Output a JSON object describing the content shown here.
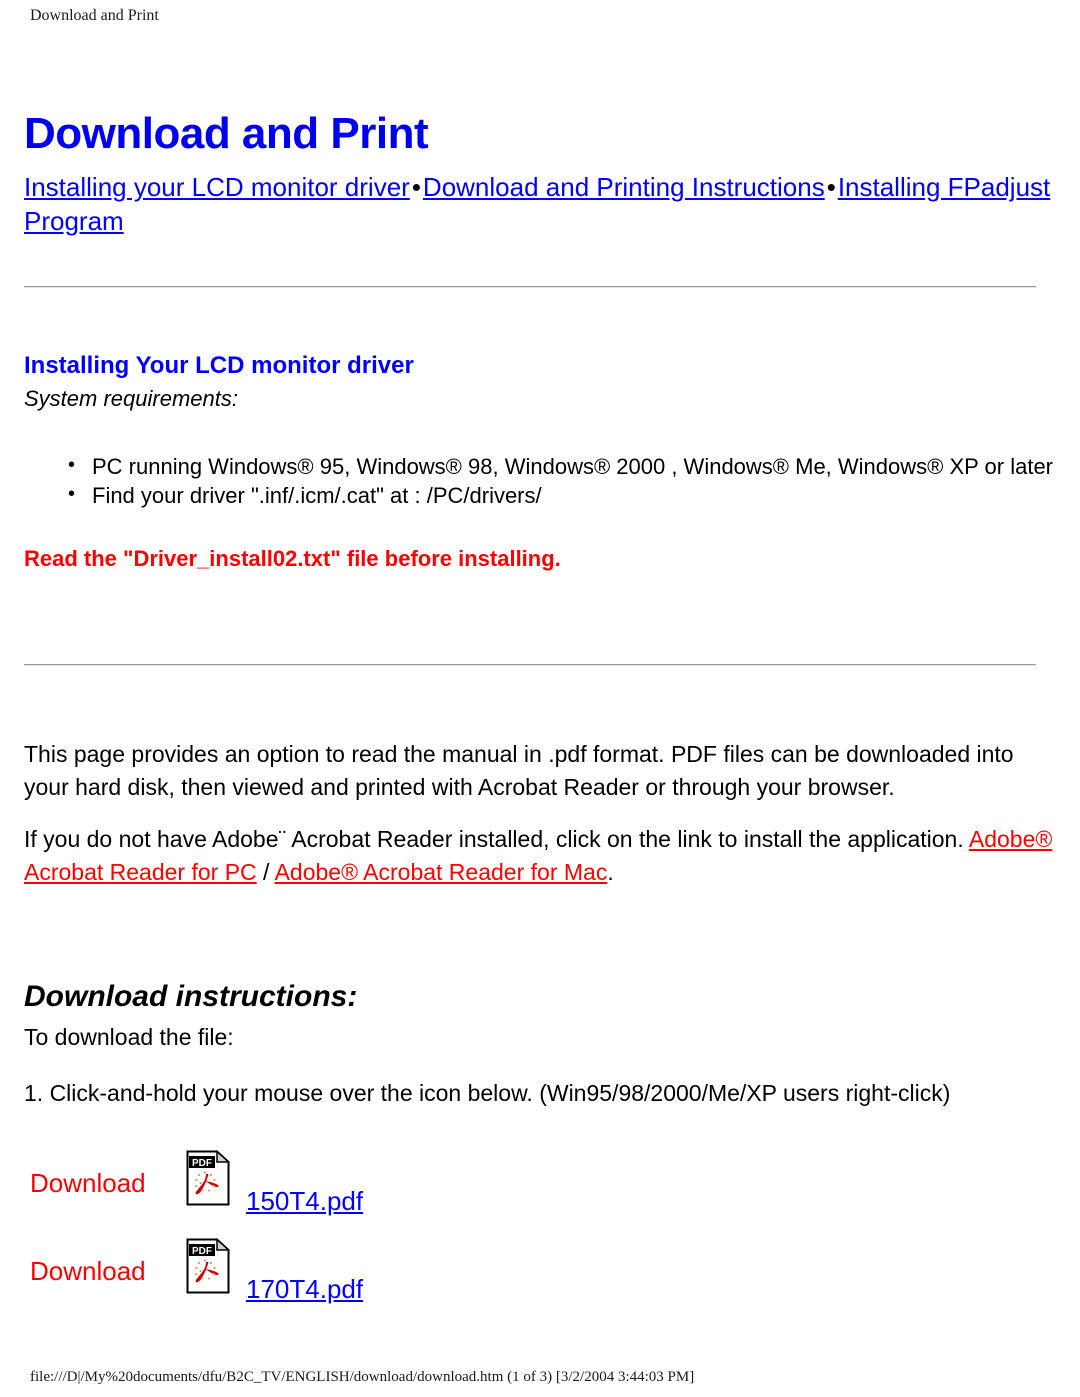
{
  "header": {
    "running_title": "Download and Print"
  },
  "title": "Download and Print",
  "nav": {
    "links": [
      {
        "label": "Installing your LCD monitor driver"
      },
      {
        "label": "Download and Printing Instructions"
      },
      {
        "label": "Installing FPadjust Program"
      }
    ],
    "separator": "•"
  },
  "driver_section": {
    "heading": "Installing Your LCD monitor driver",
    "subheading": "System requirements:",
    "requirements": [
      "PC running Windows® 95, Windows® 98, Windows® 2000 , Windows® Me, Windows® XP or later",
      "Find your driver \".inf/.icm/.cat\" at : /PC/drivers/"
    ],
    "warning": "Read the \"Driver_install02.txt\" file before installing."
  },
  "pdf_section": {
    "paragraph1": "This page provides an option to read the manual in .pdf format. PDF files can be downloaded into your hard disk, then viewed and printed with Acrobat Reader or through your browser.",
    "paragraph2_pre": "If you do not have Adobe¨ Acrobat Reader installed, click on the link to install the application. ",
    "link_pc": "Adobe® Acrobat Reader for PC",
    "paragraph2_mid": " / ",
    "link_mac": "Adobe® Acrobat Reader for Mac",
    "paragraph2_post": "."
  },
  "download_section": {
    "heading": "Download instructions:",
    "intro": "To download the file:",
    "step1": "1. Click-and-hold your mouse over the icon below. (Win95/98/2000/Me/XP users right-click)",
    "items": [
      {
        "label": "Download",
        "icon": "pdf-file-icon",
        "filename": "150T4.pdf"
      },
      {
        "label": "Download",
        "icon": "pdf-file-icon",
        "filename": "170T4.pdf"
      }
    ]
  },
  "footer": {
    "path": "file:///D|/My%20documents/dfu/B2C_TV/ENGLISH/download/download.htm (1 of 3) [3/2/2004 3:44:03 PM]"
  },
  "colors": {
    "title_blue": "#0000EE",
    "link_blue": "#0000FF",
    "warning_red": "#FF0000",
    "adobe_link_red": "#FF0000",
    "text_black": "#000000",
    "background": "#FFFFFF"
  }
}
